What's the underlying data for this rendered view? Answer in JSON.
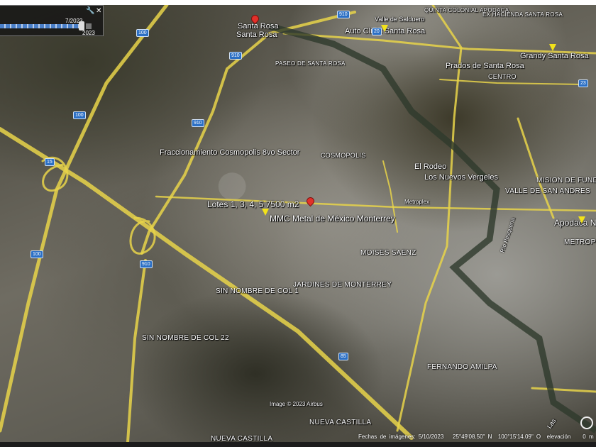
{
  "timeslider": {
    "current_date": "7/2023",
    "end_year": "2023",
    "icons": [
      "wrench-icon",
      "close-icon"
    ]
  },
  "labels": {
    "santa_rosa_1": "Santa Rosa",
    "santa_rosa_2": "Santa Rosa",
    "quinta_colonial": "QUINTA COLONIAL APODACA",
    "valle_salduero": "Valle de Salduero",
    "auto_clinic": "Auto Clinic Santa Rosa",
    "hacienda": "EX HACIENDA SANTA ROSA",
    "grandy": "Grandy Santa Rosa",
    "paseo": "PASEO DE SANTA ROSA",
    "prados": "Prados de Santa Rosa",
    "centro": "CENTRO",
    "cosmopolis_frac": "Fraccionamiento Cosmopolis 8vo Sector",
    "cosmopolis": "COSMOPOLIS",
    "el_rodeo": "El Rodeo",
    "nuevos_vergeles": "Los Nuevos Vergeles",
    "mision": "MISION DE FUNDADORES",
    "valle_san_andres": "VALLE DE SAN ANDRES",
    "metroplex": "Metroplex",
    "lotes": "Lotes 1, 3, 4, 5 7500 m2",
    "mmc": "MMC Metal de México Monterrey",
    "apodaca": "Apodaca N",
    "metropolitana": "METROPOL",
    "rio_pesqueria": "Río Pesquería",
    "moises_saenz": "MOISES SAENZ",
    "jardines": "JARDINES DE MONTERREY",
    "sin_nombre_1": "SIN NOMBRE DE COL 1",
    "sin_nombre_22": "SIN NOMBRE DE COL 22",
    "fernando_amilpa": "FERNANDO AMILPA",
    "image_credit": "Image © 2023 Airbus",
    "nueva_castilla_1": "NUEVA CASTILLA",
    "nueva_castilla_2": "NUEVA CASTILLA",
    "las": "Las"
  },
  "shields": [
    "100",
    "100",
    "100",
    "910",
    "910",
    "910",
    "910",
    "85",
    "23",
    "20",
    "15"
  ],
  "status": {
    "imagery_date_label": "Fechas de imágenes:",
    "imagery_date": "5/10/2023",
    "lat": "25°49'08.50\" N",
    "lon": "100°15'14.09\" O",
    "elevation_label": "elevación",
    "elevation": "0 m"
  },
  "colors": {
    "road": "#e8d44a",
    "pin_red": "#e2302a",
    "pin_yellow": "#f2e21a",
    "shield": "#2b6fc4"
  }
}
